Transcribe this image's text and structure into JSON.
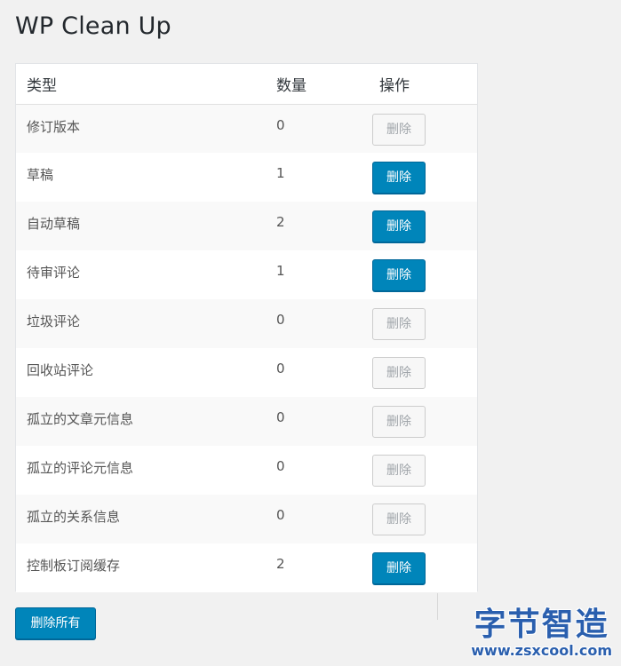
{
  "page": {
    "title": "WP Clean Up"
  },
  "table": {
    "headers": {
      "type": "类型",
      "count": "数量",
      "action": "操作"
    },
    "rows": [
      {
        "type": "修订版本",
        "count": "0",
        "button": "删除",
        "enabled": false
      },
      {
        "type": "草稿",
        "count": "1",
        "button": "删除",
        "enabled": true
      },
      {
        "type": "自动草稿",
        "count": "2",
        "button": "删除",
        "enabled": true
      },
      {
        "type": "待审评论",
        "count": "1",
        "button": "删除",
        "enabled": true
      },
      {
        "type": "垃圾评论",
        "count": "0",
        "button": "删除",
        "enabled": false
      },
      {
        "type": "回收站评论",
        "count": "0",
        "button": "删除",
        "enabled": false
      },
      {
        "type": "孤立的文章元信息",
        "count": "0",
        "button": "删除",
        "enabled": false
      },
      {
        "type": "孤立的评论元信息",
        "count": "0",
        "button": "删除",
        "enabled": false
      },
      {
        "type": "孤立的关系信息",
        "count": "0",
        "button": "删除",
        "enabled": false
      },
      {
        "type": "控制板订阅缓存",
        "count": "2",
        "button": "删除",
        "enabled": true
      }
    ]
  },
  "actions": {
    "delete_all": "删除所有"
  },
  "watermark": {
    "main": "字节智造",
    "sub": "www.zsxcool.com"
  },
  "colors": {
    "primary": "#0085ba",
    "primary_border": "#006799",
    "disabled_bg": "#f7f7f7",
    "disabled_text": "#a0a5aa",
    "page_bg": "#f1f1f1"
  }
}
